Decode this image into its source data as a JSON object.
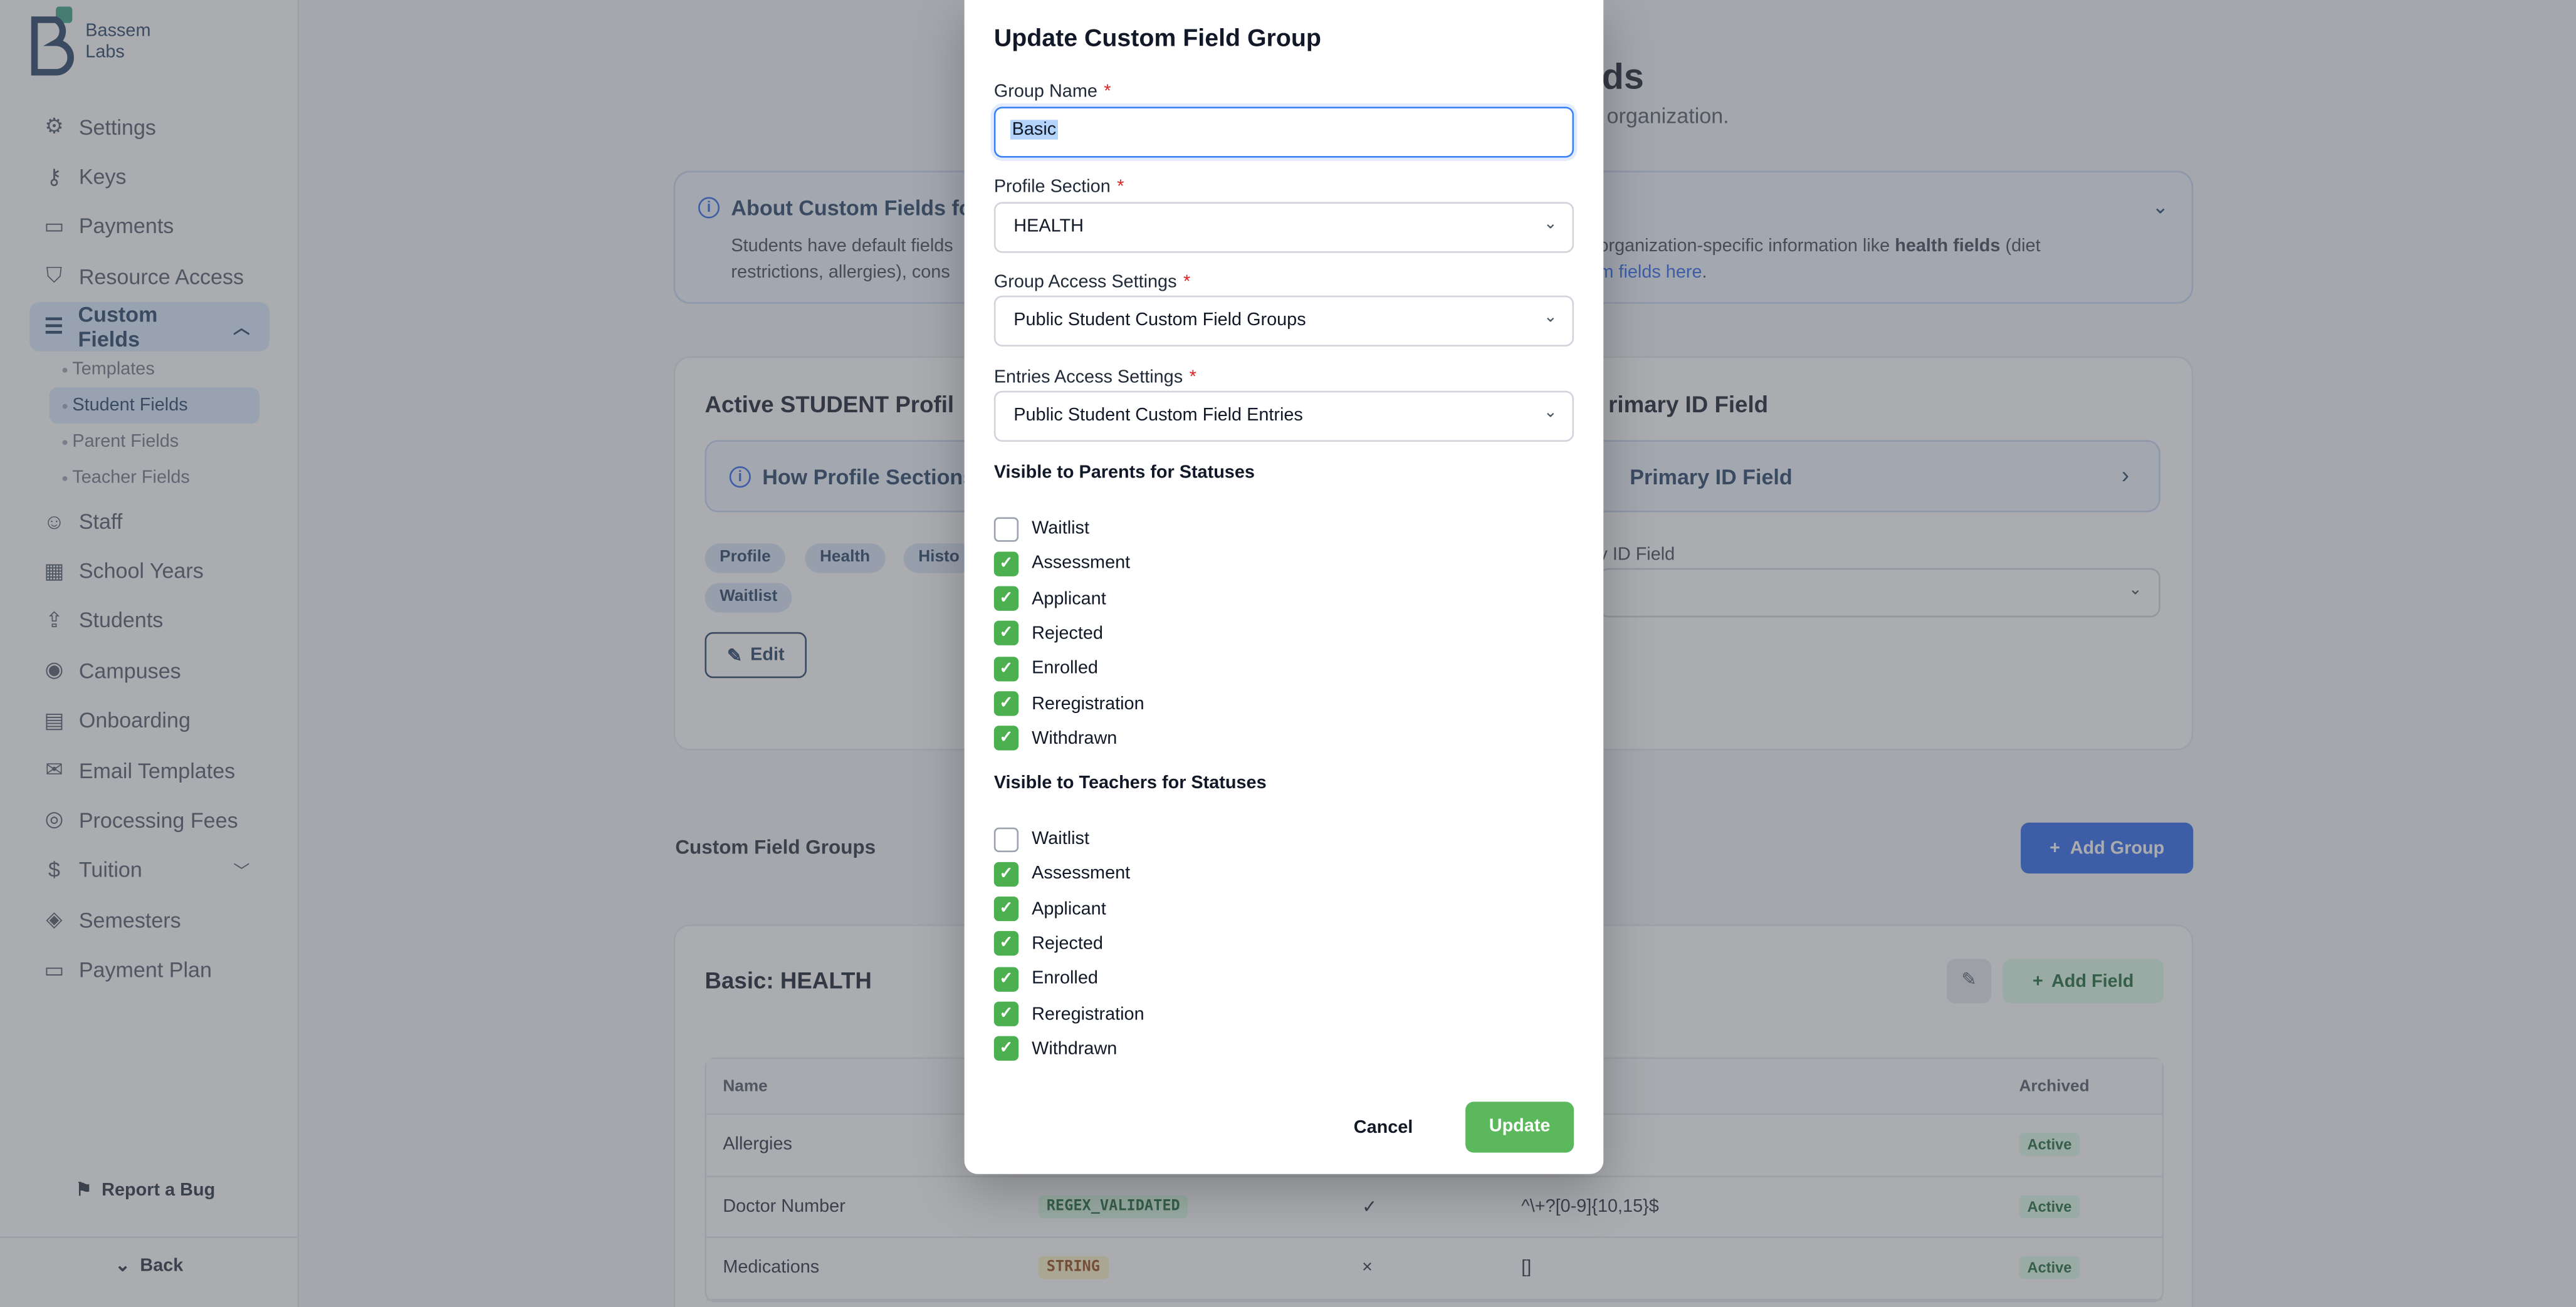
{
  "brand": {
    "name_line1": "Bassem",
    "name_line2": "Labs"
  },
  "sidebar": {
    "items": [
      {
        "label": "Settings",
        "icon": "gear-icon"
      },
      {
        "label": "Keys",
        "icon": "key-icon"
      },
      {
        "label": "Payments",
        "icon": "card-icon"
      },
      {
        "label": "Resource Access",
        "icon": "shield-icon"
      },
      {
        "label": "Custom Fields",
        "icon": "list-icon",
        "active": true
      },
      {
        "label": "Staff",
        "icon": "users-icon"
      },
      {
        "label": "School Years",
        "icon": "calendar-icon"
      },
      {
        "label": "Students",
        "icon": "upload-icon"
      },
      {
        "label": "Campuses",
        "icon": "map-pin-icon"
      },
      {
        "label": "Onboarding",
        "icon": "document-icon"
      },
      {
        "label": "Email Templates",
        "icon": "mail-icon"
      },
      {
        "label": "Processing Fees",
        "icon": "fee-icon"
      },
      {
        "label": "Tuition",
        "icon": "dollar-icon"
      },
      {
        "label": "Semesters",
        "icon": "layers-icon"
      },
      {
        "label": "Payment Plan",
        "icon": "card-icon"
      }
    ],
    "sub_items": [
      "Templates",
      "Student Fields",
      "Parent Fields",
      "Teacher Fields"
    ],
    "report_bug": "Report a Bug",
    "back": "Back"
  },
  "background": {
    "title_fragment": "ds",
    "subtitle_fragment": "organization.",
    "info": {
      "title": "About Custom Fields for",
      "body_left": "Students have default fields restrictions, allergies), cons",
      "body_right_1": "organization-specific information like ",
      "body_right_bold": "health fields",
      "body_right_2": " (diet",
      "body_right_link": "m fields here",
      "body_right_end": "."
    },
    "profile_title": "Active STUDENT Profil",
    "primary_title": "rimary ID Field",
    "how_text": "How Profile Sections",
    "primary_how": "Primary ID Field",
    "pills": [
      "Profile",
      "Health",
      "Histo",
      "Waitlist"
    ],
    "edit": "Edit",
    "primary_label": "y ID Field",
    "groups_label": "Custom Field Groups",
    "add_group": "Add Group",
    "group_title": "Basic: HEALTH",
    "add_field": "Add Field",
    "table": {
      "headers": {
        "name": "Name",
        "archived": "Archived"
      },
      "rows": [
        {
          "name": "Allergies",
          "type": "",
          "required": "",
          "regex": "",
          "status": "Active"
        },
        {
          "name": "Doctor Number",
          "type": "REGEX_VALIDATED",
          "required": "✓",
          "regex": "^\\+?[0-9]{10,15}$",
          "status": "Active"
        },
        {
          "name": "Medications",
          "type": "STRING",
          "required": "×",
          "regex": "[]",
          "status": "Active"
        }
      ]
    }
  },
  "modal": {
    "title": "Update Custom Field Group",
    "group_name_label": "Group Name",
    "group_name_value": "Basic",
    "profile_section_label": "Profile Section",
    "profile_section_value": "HEALTH",
    "group_access_label": "Group Access Settings",
    "group_access_value": "Public Student Custom Field Groups",
    "entries_access_label": "Entries Access Settings",
    "entries_access_value": "Public Student Custom Field Entries",
    "parents_heading": "Visible to Parents for Statuses",
    "teachers_heading": "Visible to Teachers for Statuses",
    "statuses": [
      "Waitlist",
      "Assessment",
      "Applicant",
      "Rejected",
      "Enrolled",
      "Reregistration",
      "Withdrawn"
    ],
    "parents_checked": [
      false,
      true,
      true,
      true,
      true,
      true,
      true
    ],
    "teachers_checked": [
      false,
      true,
      true,
      true,
      true,
      true,
      true
    ],
    "cancel": "Cancel",
    "update": "Update",
    "required_mark": "*"
  },
  "colors": {
    "accent": "#2563eb",
    "checkbox": "#4caf50",
    "update": "#5cb85c",
    "brand": "#1e3a5f"
  }
}
